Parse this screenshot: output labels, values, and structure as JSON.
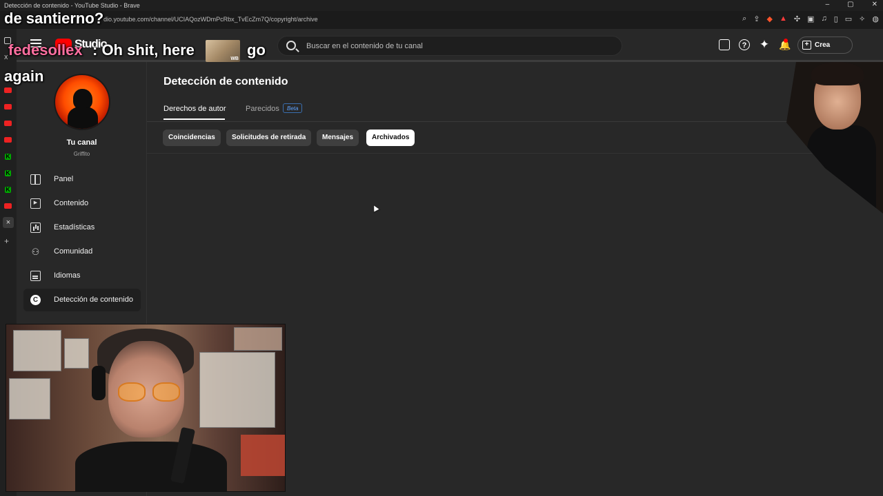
{
  "browser": {
    "window_title": "Detección de contenido - YouTube Studio - Brave",
    "url": "dio.youtube.com/channel/UCIAQozWDmPcRbx_TvEcZm7Q/copyright/archive",
    "window_controls": [
      "–",
      "▢",
      "✕"
    ]
  },
  "header": {
    "logo_text": "Studio",
    "search_placeholder": "Buscar en el contenido de tu canal",
    "create_label": "Crea"
  },
  "sidebar": {
    "channel_title": "Tu canal",
    "channel_name": "Griffito",
    "items": [
      {
        "label": "Panel",
        "icon": "dashboard-icon"
      },
      {
        "label": "Contenido",
        "icon": "content-icon"
      },
      {
        "label": "Estadísticas",
        "icon": "analytics-icon"
      },
      {
        "label": "Comunidad",
        "icon": "community-icon"
      },
      {
        "label": "Idiomas",
        "icon": "subtitles-icon"
      },
      {
        "label": "Detección de contenido",
        "icon": "copyright-icon",
        "active": true
      }
    ]
  },
  "main": {
    "title": "Detección de contenido",
    "tabs": [
      {
        "label": "Derechos de autor",
        "active": true
      },
      {
        "label": "Parecidos",
        "badge": "Beta"
      }
    ],
    "chips": [
      {
        "label": "Coincidencias"
      },
      {
        "label": "Solicitudes de retirada"
      },
      {
        "label": "Mensajes"
      },
      {
        "label": "Archivados",
        "active": true
      }
    ]
  },
  "overlay": {
    "caption_line1": "de santierno?",
    "chat_user": "fedesollex",
    "chat_message": ": Oh shit, here",
    "chat_message_end": "go",
    "caption_line3": "again"
  },
  "colors": {
    "background": "#282828",
    "accent_red": "#ff0000",
    "beta_blue": "#5ea2ff",
    "chat_user": "#ff6fa0"
  }
}
